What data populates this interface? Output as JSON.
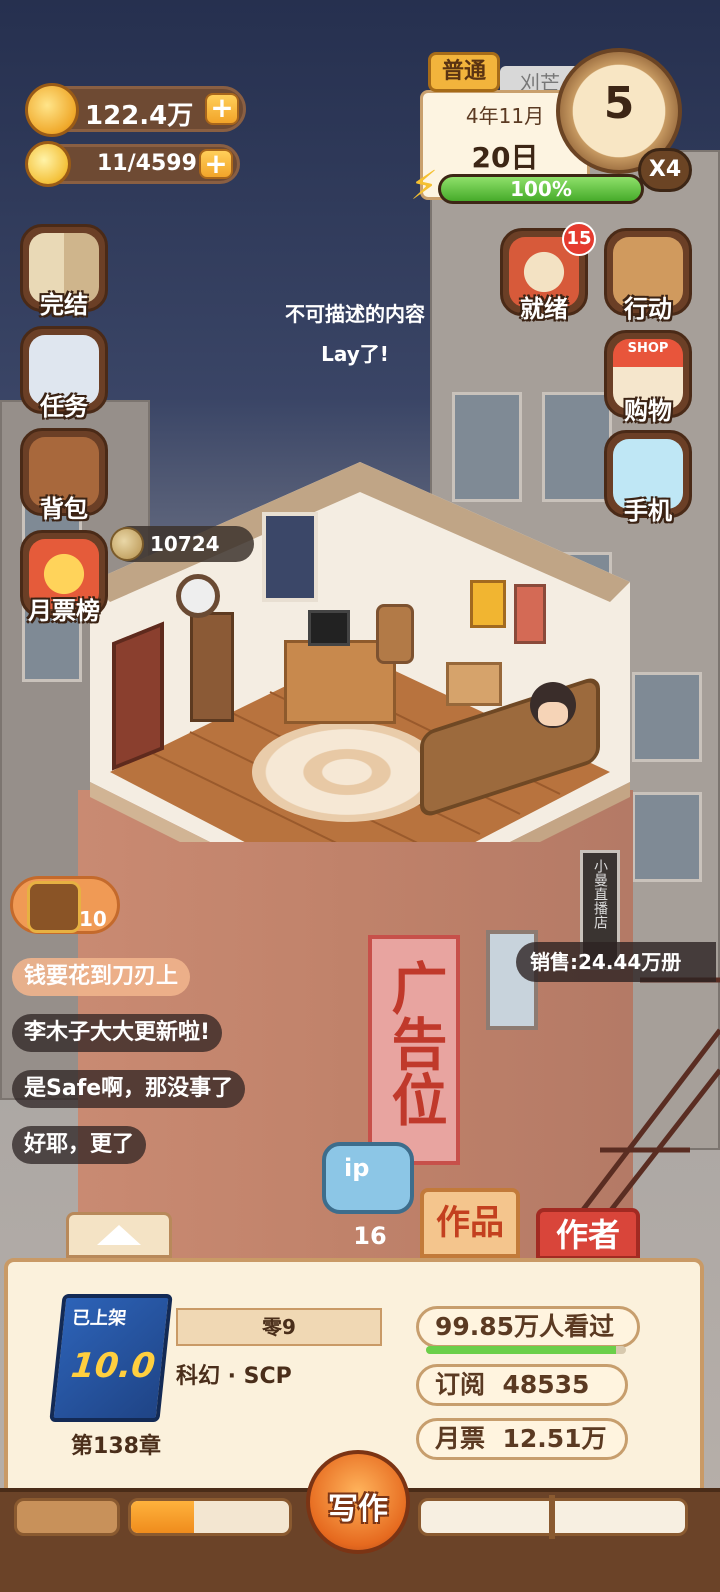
{
  "resources": {
    "coins": "122.4万",
    "energy": "11/4599"
  },
  "calendar": {
    "difficulty": "普通",
    "tag": "刈芒",
    "month": "4年11月",
    "day": "20日",
    "countdown": "5",
    "speed": "X4",
    "stamina": "100%",
    "stamina_percent": 100
  },
  "left_menu": [
    {
      "label": "完结",
      "icon": "book-icon"
    },
    {
      "label": "任务",
      "icon": "checklist-icon"
    },
    {
      "label": "背包",
      "icon": "backpack-icon"
    },
    {
      "label": "月票榜",
      "icon": "monthly-ticket-icon"
    }
  ],
  "right_menu": [
    {
      "label": "就绪",
      "icon": "alarm-icon",
      "badge": "15"
    },
    {
      "label": "行动",
      "icon": "door-icon"
    },
    {
      "label": "购物",
      "icon": "shop-icon",
      "sign": "SHOP"
    },
    {
      "label": "手机",
      "icon": "phone-icon"
    }
  ],
  "bubble": {
    "line1": "不可描述的内容",
    "line2": "Lay了!"
  },
  "coin_bubble": "10724",
  "chest": {
    "count": "10"
  },
  "sales": "销售:24.44万册",
  "chats": [
    "钱要花到刀刃上",
    "李木子大大更新啦!",
    "是Safe啊，那没事了",
    "好耶，更了"
  ],
  "building_sign": "小曼直播店",
  "poster": "广告位",
  "ip": {
    "label": "ip",
    "count": "16"
  },
  "tabs": {
    "works": "作品",
    "author": "作者"
  },
  "book": {
    "status": "已上架",
    "score": "10.0",
    "name": "零9",
    "genre": "科幻 · SCP",
    "chapter": "第138章",
    "views": "99.85万人看过",
    "views_fill": 0.95,
    "subscribe_label": "订阅",
    "subscribe": "48535",
    "monthly_label": "月票",
    "monthly": "12.51万"
  },
  "write_button": "写作",
  "progress_fill": 0.4
}
